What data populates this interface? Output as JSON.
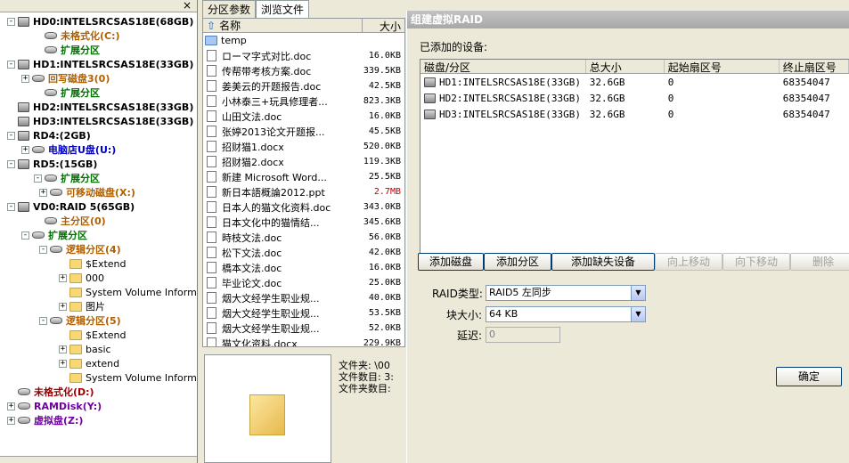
{
  "tree": {
    "close_glyph": "×",
    "nodes": [
      {
        "label": "HD0:INTELSRCSAS18E(68GB)",
        "icon": "disk-icon",
        "color": "black"
      },
      {
        "label": "未格式化(C:)",
        "icon": "partition-icon",
        "color": "orange"
      },
      {
        "label": "扩展分区",
        "icon": "partition-icon",
        "color": "green"
      },
      {
        "label": "HD1:INTELSRCSAS18E(33GB)",
        "icon": "disk-icon",
        "color": "black"
      },
      {
        "label": "回写磁盘3(0)",
        "icon": "partition-icon",
        "color": "orange"
      },
      {
        "label": "扩展分区",
        "icon": "partition-icon",
        "color": "green"
      },
      {
        "label": "HD2:INTELSRCSAS18E(33GB)",
        "icon": "disk-icon",
        "color": "black"
      },
      {
        "label": "HD3:INTELSRCSAS18E(33GB)",
        "icon": "disk-icon",
        "color": "black"
      },
      {
        "label": "RD4:(2GB)",
        "icon": "disk-icon",
        "color": "black"
      },
      {
        "label": "电脑店U盘(U:)",
        "icon": "partition-icon",
        "color": "blue"
      },
      {
        "label": "RD5:(15GB)",
        "icon": "disk-icon",
        "color": "black"
      },
      {
        "label": "扩展分区",
        "icon": "partition-icon",
        "color": "green"
      },
      {
        "label": "可移动磁盘(X:)",
        "icon": "partition-icon",
        "color": "orange"
      },
      {
        "label": "VD0:RAID 5(65GB)",
        "icon": "disk-icon",
        "color": "black"
      },
      {
        "label": "主分区(0)",
        "icon": "partition-icon",
        "color": "orange"
      },
      {
        "label": "扩展分区",
        "icon": "partition-icon",
        "color": "green"
      },
      {
        "label": "逻辑分区(4)",
        "icon": "partition-icon",
        "color": "orange"
      },
      {
        "label": "$Extend",
        "icon": "folder-icon",
        "color": "black"
      },
      {
        "label": "000",
        "icon": "folder-icon",
        "color": "black"
      },
      {
        "label": "System Volume Inform",
        "icon": "folder-icon",
        "color": "black"
      },
      {
        "label": "图片",
        "icon": "folder-icon",
        "color": "black"
      },
      {
        "label": "逻辑分区(5)",
        "icon": "partition-icon",
        "color": "orange"
      },
      {
        "label": "$Extend",
        "icon": "folder-icon",
        "color": "black"
      },
      {
        "label": "basic",
        "icon": "folder-icon",
        "color": "black"
      },
      {
        "label": "extend",
        "icon": "folder-icon",
        "color": "black"
      },
      {
        "label": "System Volume Inform",
        "icon": "folder-icon",
        "color": "black"
      },
      {
        "label": "未格式化(D:)",
        "icon": "partition-icon",
        "color": "red"
      },
      {
        "label": "RAMDisk(Y:)",
        "icon": "partition-icon",
        "color": "purple"
      },
      {
        "label": "虚拟盘(Z:)",
        "icon": "partition-icon",
        "color": "purple"
      }
    ]
  },
  "tabs": [
    "分区参数",
    "浏览文件"
  ],
  "files": {
    "col_name": "名称",
    "col_size": "大小",
    "up_glyph": "⇧",
    "rows": [
      {
        "name": "temp",
        "size": "",
        "type": "folder"
      },
      {
        "name": "ローマ字式对比.doc",
        "size": "16.0KB"
      },
      {
        "name": "传帮带考核方案.doc",
        "size": "339.5KB"
      },
      {
        "name": "姜美云的开题报告.doc",
        "size": "42.5KB"
      },
      {
        "name": "小林泰三+玩具修理者...",
        "size": "823.3KB"
      },
      {
        "name": "山田文法.doc",
        "size": "16.0KB"
      },
      {
        "name": "张婷2013论文开题报...",
        "size": "45.5KB"
      },
      {
        "name": "招财猫1.docx",
        "size": "520.0KB"
      },
      {
        "name": "招财猫2.docx",
        "size": "119.3KB"
      },
      {
        "name": "新建 Microsoft Word...",
        "size": "25.5KB"
      },
      {
        "name": "新日本語概論2012.ppt",
        "size": "2.7MB",
        "red": true
      },
      {
        "name": "日本人的猫文化资料.doc",
        "size": "343.0KB"
      },
      {
        "name": "日本文化中的猫情结...",
        "size": "345.6KB"
      },
      {
        "name": "時枝文法.doc",
        "size": "56.0KB"
      },
      {
        "name": "松下文法.doc",
        "size": "42.0KB"
      },
      {
        "name": "橋本文法.doc",
        "size": "16.0KB"
      },
      {
        "name": "毕业论文.doc",
        "size": "25.0KB"
      },
      {
        "name": "烟大文经学生职业规...",
        "size": "40.0KB"
      },
      {
        "name": "烟大文经学生职业规...",
        "size": "53.5KB"
      },
      {
        "name": "烟大文经学生职业规...",
        "size": "52.0KB"
      },
      {
        "name": "猫文化资料.docx",
        "size": "229.9KB"
      }
    ]
  },
  "info": {
    "folder_line": "文件夹: \\00",
    "filecount_line": "文件数目: 3:",
    "foldercount_line": "文件夹数目:"
  },
  "dialog": {
    "title": "组建虚拟RAID",
    "added_label": "已添加的设备:",
    "columns": [
      "磁盘/分区",
      "总大小",
      "起始扇区号",
      "终止扇区号"
    ],
    "devices": [
      {
        "name": "HD1:INTELSRCSAS18E(33GB)",
        "size": "32.6GB",
        "start": "0",
        "end": "68354047"
      },
      {
        "name": "HD2:INTELSRCSAS18E(33GB)",
        "size": "32.6GB",
        "start": "0",
        "end": "68354047"
      },
      {
        "name": "HD3:INTELSRCSAS18E(33GB)",
        "size": "32.6GB",
        "start": "0",
        "end": "68354047"
      }
    ],
    "buttons": [
      {
        "label": "添加磁盘",
        "enabled": true
      },
      {
        "label": "添加分区",
        "enabled": true
      },
      {
        "label": "添加缺失设备",
        "enabled": true
      },
      {
        "label": "向上移动",
        "enabled": false
      },
      {
        "label": "向下移动",
        "enabled": false
      },
      {
        "label": "删除",
        "enabled": false
      }
    ],
    "raid_type_label": "RAID类型:",
    "raid_type_value": "RAID5 左同步",
    "block_label": "块大小:",
    "block_value": "64 KB",
    "delay_label": "延迟:",
    "delay_value": "0",
    "ok_label": "确定"
  }
}
